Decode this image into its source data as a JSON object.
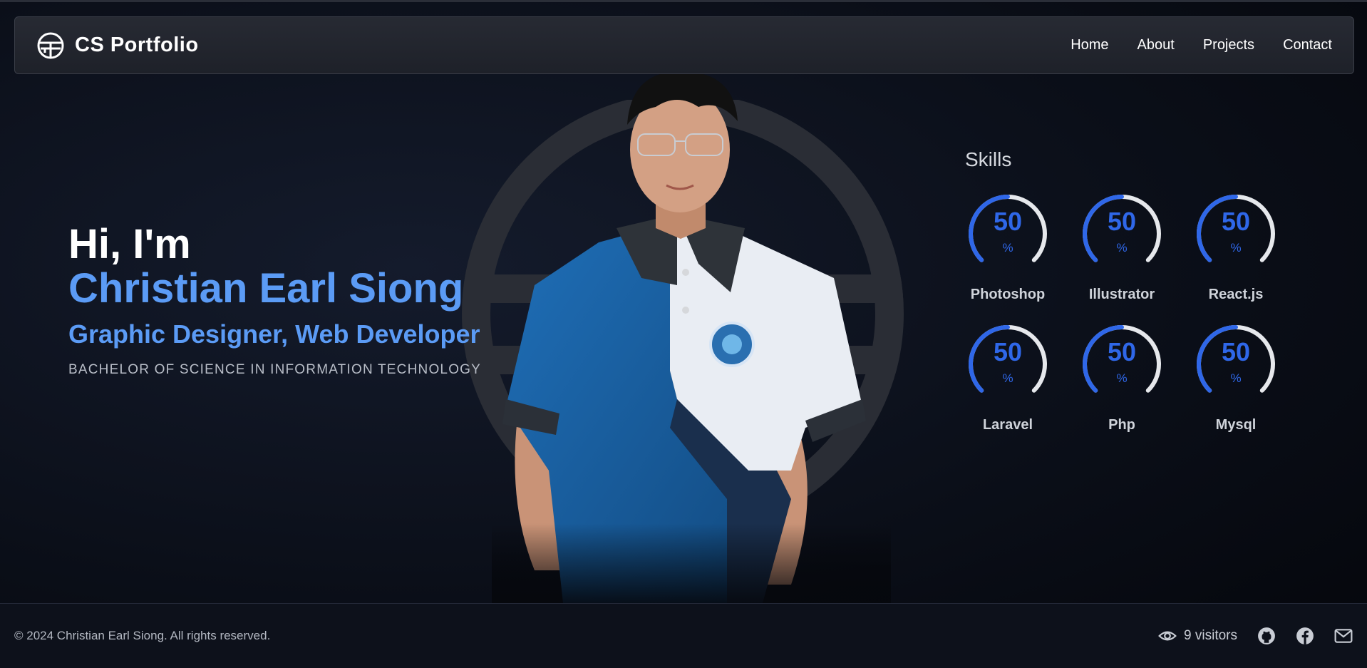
{
  "navbar": {
    "brand": "CS Portfolio",
    "links": [
      "Home",
      "About",
      "Projects",
      "Contact"
    ]
  },
  "hero": {
    "greeting": "Hi, I'm",
    "name": "Christian Earl Siong",
    "role": "Graphic Designer, Web Developer",
    "degree": "BACHELOR OF SCIENCE IN INFORMATION TECHNOLOGY"
  },
  "skills": {
    "title": "Skills",
    "items": [
      {
        "name": "Photoshop",
        "value": "50",
        "unit": "%",
        "percent": 50
      },
      {
        "name": "Illustrator",
        "value": "50",
        "unit": "%",
        "percent": 50
      },
      {
        "name": "React.js",
        "value": "50",
        "unit": "%",
        "percent": 50
      },
      {
        "name": "Laravel",
        "value": "50",
        "unit": "%",
        "percent": 50
      },
      {
        "name": "Php",
        "value": "50",
        "unit": "%",
        "percent": 50
      },
      {
        "name": "Mysql",
        "value": "50",
        "unit": "%",
        "percent": 50
      }
    ]
  },
  "footer": {
    "copyright": "© 2024 Christian Earl Siong. All rights reserved.",
    "visitors": "9 visitors",
    "icons": [
      "eye-icon",
      "github-icon",
      "facebook-icon",
      "mail-icon"
    ]
  },
  "colors": {
    "accent": "#5b9bf5",
    "gauge": "#2f67e8",
    "gauge_track": "#e6e8ec"
  }
}
